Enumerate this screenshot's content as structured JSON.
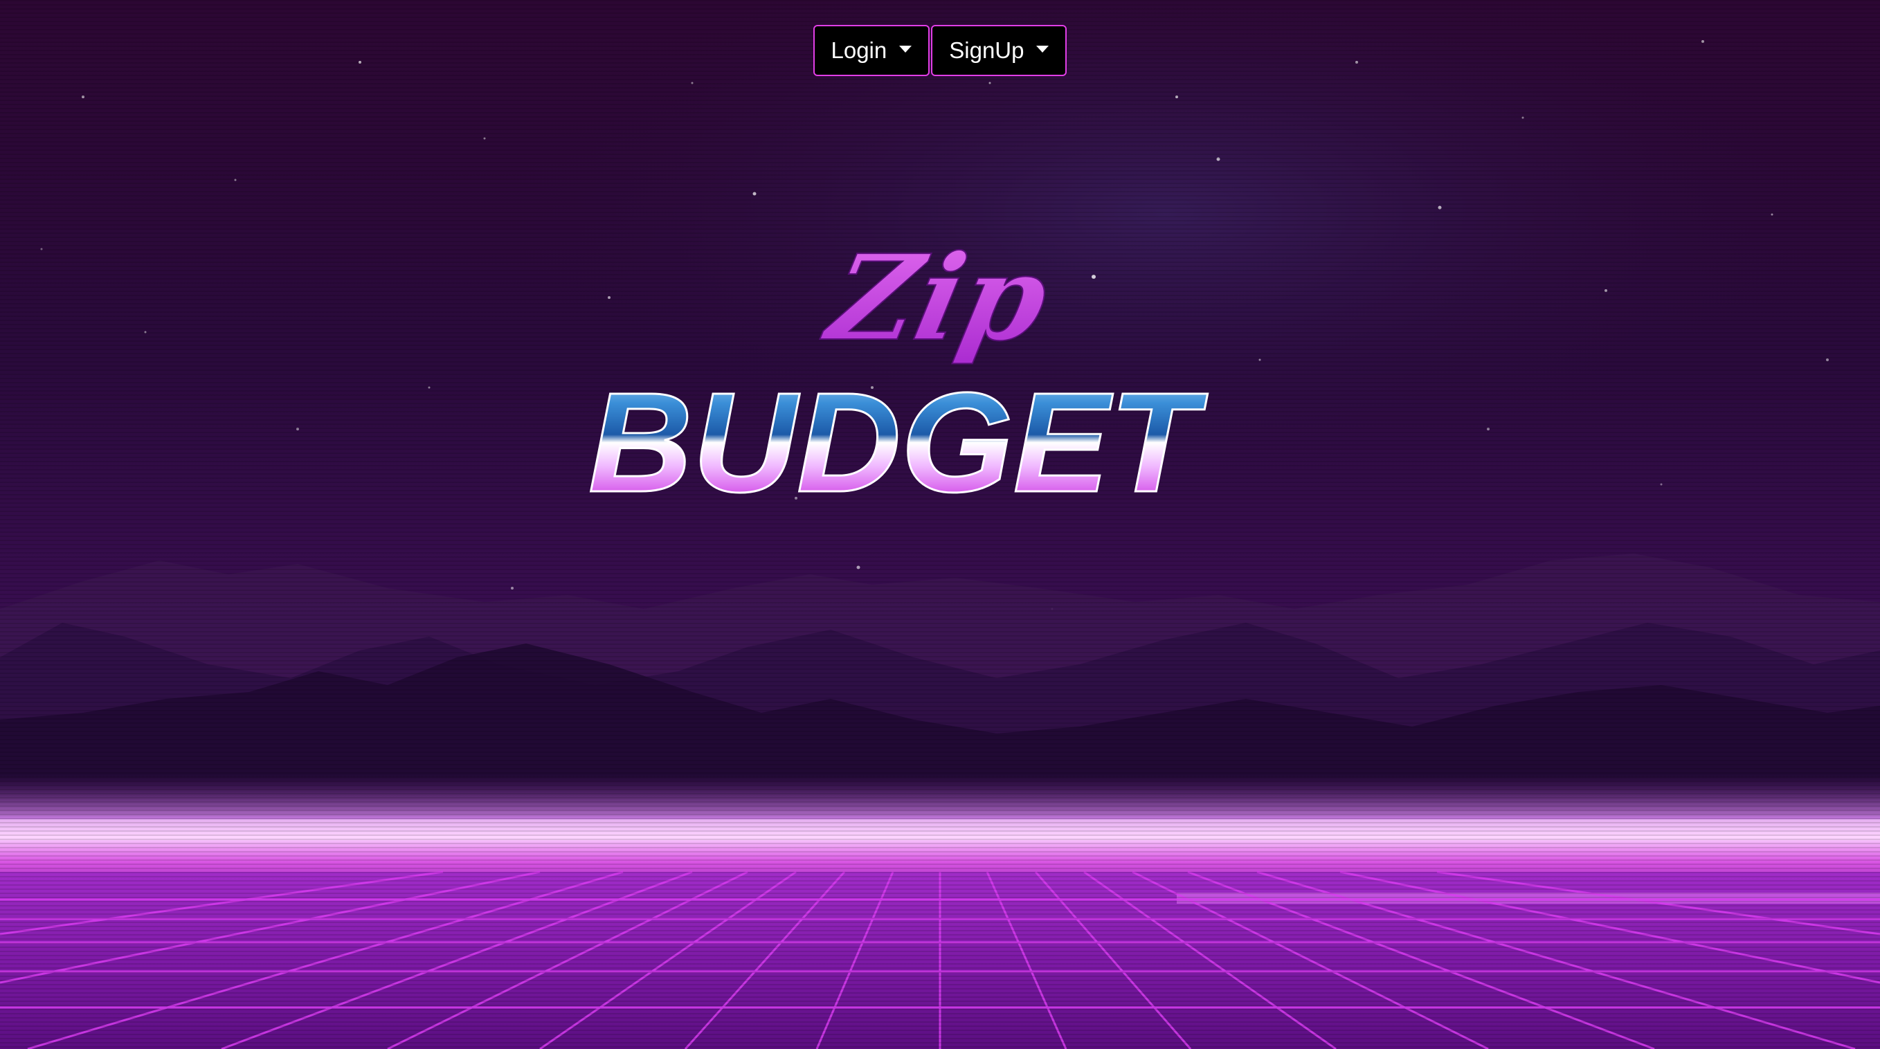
{
  "nav": {
    "login_label": "Login",
    "signup_label": "SignUp"
  },
  "logo": {
    "script_text": "Zip",
    "block_text": "BUDGET"
  },
  "colors": {
    "accent": "#e13ee6",
    "button_bg": "#000000",
    "sky_top": "#2a0834",
    "horizon_glow": "#f7a6ff",
    "grid_line": "#d028e6"
  },
  "icons": {
    "dropdown": "chevron-down-icon"
  }
}
